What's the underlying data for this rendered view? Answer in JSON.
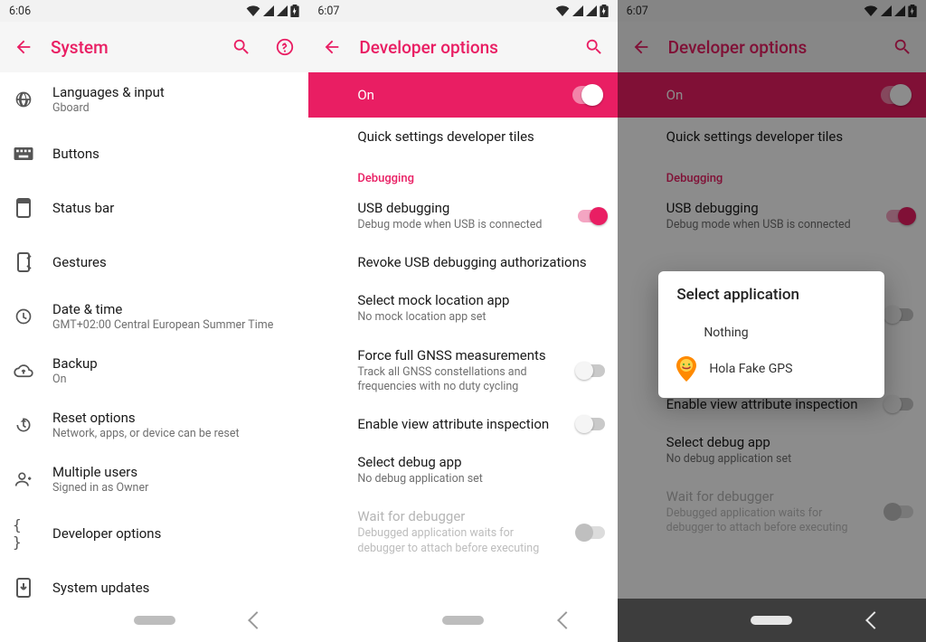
{
  "accent": "#e91e63",
  "screen1": {
    "status_time": "6:06",
    "title": "System",
    "items": [
      {
        "icon": "globe",
        "title": "Languages & input",
        "sub": "Gboard"
      },
      {
        "icon": "keyboard",
        "title": "Buttons"
      },
      {
        "icon": "phone-rect",
        "title": "Status bar"
      },
      {
        "icon": "gestures",
        "title": "Gestures"
      },
      {
        "icon": "clock",
        "title": "Date & time",
        "sub": "GMT+02:00 Central European Summer Time"
      },
      {
        "icon": "cloud-up",
        "title": "Backup",
        "sub": "On"
      },
      {
        "icon": "restore",
        "title": "Reset options",
        "sub": "Network, apps, or device can be reset"
      },
      {
        "icon": "user",
        "title": "Multiple users",
        "sub": "Signed in as Owner"
      },
      {
        "icon": "braces",
        "title": "Developer options"
      },
      {
        "icon": "update",
        "title": "System updates"
      }
    ]
  },
  "screen2": {
    "status_time": "6:07",
    "title": "Developer options",
    "master_label": "On",
    "quick_tiles": "Quick settings developer tiles",
    "section_debugging": "Debugging",
    "rows": {
      "usb": {
        "t": "USB debugging",
        "s": "Debug mode when USB is connected"
      },
      "revoke": {
        "t": "Revoke USB debugging authorizations"
      },
      "mock": {
        "t": "Select mock location app",
        "s": "No mock location app set"
      },
      "gnss": {
        "t": "Force full GNSS measurements",
        "s": "Track all GNSS constellations and frequencies with no duty cycling"
      },
      "view_inspect": {
        "t": "Enable view attribute inspection"
      },
      "debug_app": {
        "t": "Select debug app",
        "s": "No debug application set"
      },
      "wait_dbg": {
        "t": "Wait for debugger",
        "s": "Debugged application waits for debugger to attach before executing"
      }
    }
  },
  "screen3": {
    "status_time": "6:07",
    "dialog_title": "Select application",
    "dialog_options": {
      "nothing": "Nothing",
      "hola": "Hola Fake GPS"
    }
  }
}
